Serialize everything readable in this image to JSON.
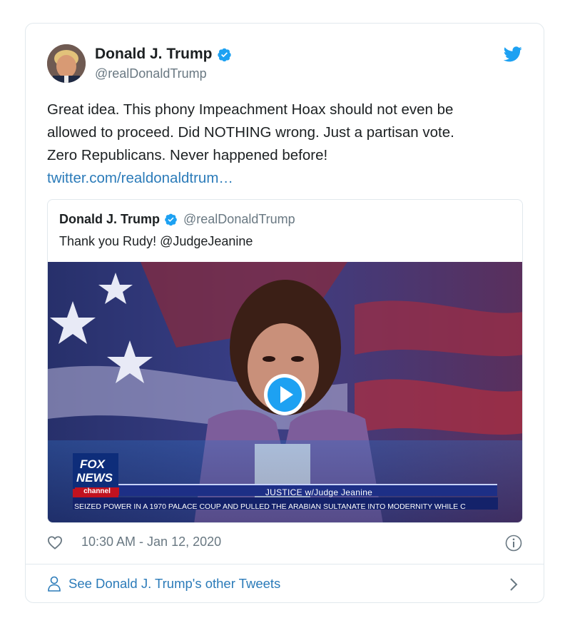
{
  "author": {
    "name": "Donald J. Trump",
    "handle": "@realDonaldTrump",
    "verified": true
  },
  "tweet": {
    "lines": [
      "Great idea. This phony Impeachment Hoax should not even be",
      "allowed to proceed. Did NOTHING wrong. Just a partisan vote.",
      "Zero Republicans. Never happened before!"
    ],
    "link": "twitter.com/realdonaldtrum…"
  },
  "quoted": {
    "name": "Donald J. Trump",
    "handle": "@realDonaldTrump",
    "text": "Thank you Rudy! @JudgeJeanine",
    "media": {
      "logo_line1": "FOX",
      "logo_line2": "NEWS",
      "logo_line3": "channel",
      "show_title": "JUSTICE w/Judge Jeanine",
      "ticker": "SEIZED POWER IN A 1970 PALACE COUP AND PULLED THE ARABIAN SULTANATE INTO MODERNITY WHILE C"
    }
  },
  "meta": {
    "timestamp": "10:30 AM - Jan 12, 2020"
  },
  "footer": {
    "link_text": "See Donald J. Trump's other Tweets"
  },
  "colors": {
    "link": "#2b7bb9",
    "verified": "#1da1f2",
    "muted": "#697882",
    "border": "#e1e8ed"
  },
  "icons": [
    "verified-badge-icon",
    "twitter-bird-icon",
    "play-icon",
    "heart-icon",
    "info-icon",
    "person-icon",
    "chevron-right-icon"
  ]
}
